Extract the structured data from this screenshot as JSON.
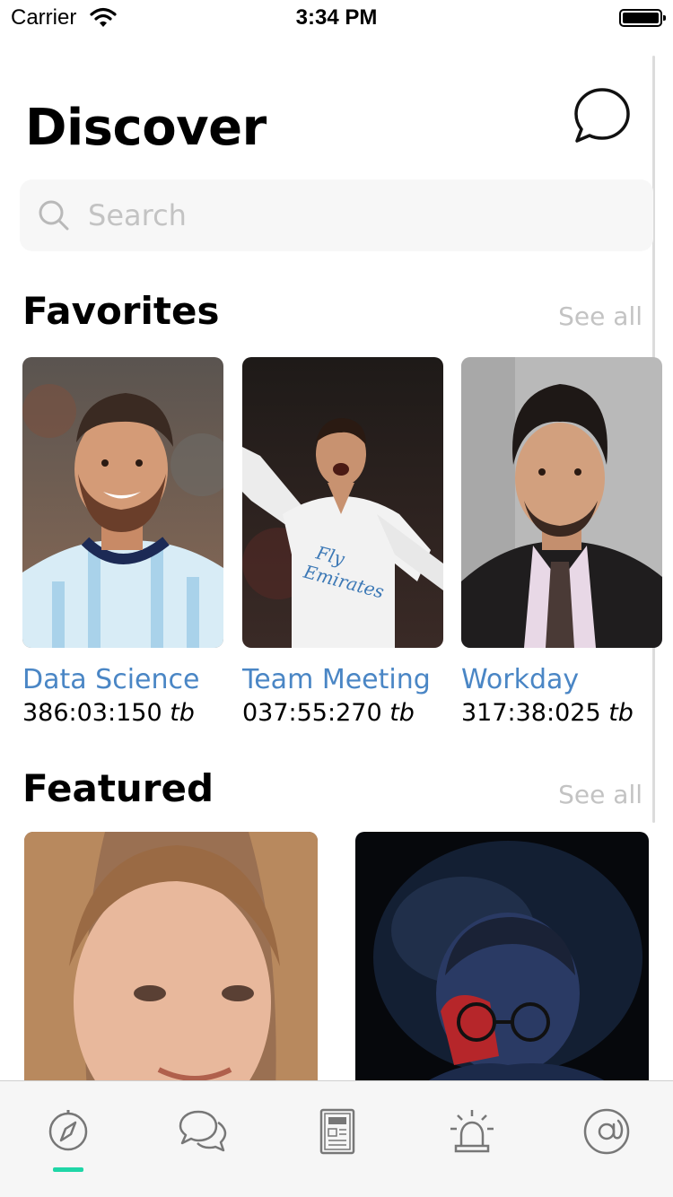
{
  "status_bar": {
    "carrier": "Carrier",
    "time": "3:34 PM"
  },
  "header": {
    "title": "Discover",
    "chat_icon": "chat-bubble-icon"
  },
  "search": {
    "placeholder": "Search",
    "icon": "search-icon"
  },
  "favorites": {
    "title": "Favorites",
    "see_all": "See all",
    "items": [
      {
        "name": "Data Science",
        "time": "386:03:150",
        "unit": "tb"
      },
      {
        "name": "Team Meeting",
        "time": "037:55:270",
        "unit": "tb"
      },
      {
        "name": "Workday",
        "time": "317:38:025",
        "unit": "tb"
      }
    ]
  },
  "featured": {
    "title": "Featured",
    "see_all": "See all"
  },
  "tab_bar": {
    "active_index": 0,
    "accent_color": "#1fd6a7",
    "items": [
      {
        "icon": "compass-icon"
      },
      {
        "icon": "chat-bubbles-icon"
      },
      {
        "icon": "newspaper-icon"
      },
      {
        "icon": "alarm-light-icon"
      },
      {
        "icon": "at-sign-icon"
      }
    ]
  },
  "colors": {
    "link": "#4a86c5",
    "muted": "#c3c3c3",
    "search_bg": "#f7f7f7"
  }
}
